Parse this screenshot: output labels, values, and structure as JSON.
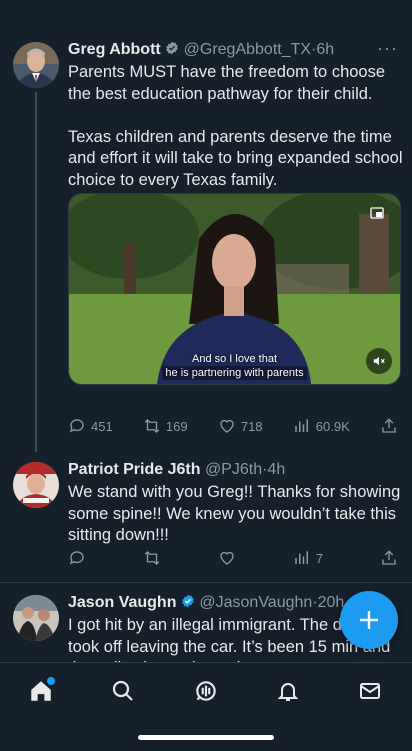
{
  "tweets": [
    {
      "name": "Greg Abbott",
      "handle": "@GregAbbott_TX",
      "time": "6h",
      "verified": true,
      "text": "Parents MUST have the freedom to choose the best education pathway for their child.\n\nTexas children and parents deserve the time and effort it will take to bring expanded school choice to every Texas family.",
      "media": {
        "caption_line1": "And so I love that",
        "caption_line2": "he is partnering with parents"
      },
      "actions": {
        "replies": "451",
        "retweets": "169",
        "likes": "718",
        "views": "60.9K"
      }
    },
    {
      "name": "Patriot Pride J6th",
      "handle": "@PJ6th",
      "time": "4h",
      "verified": false,
      "text": "We stand with you Greg!! Thanks for showing some spine!! We knew you wouldn’t take this sitting down!!!",
      "actions": {
        "views": "7"
      }
    },
    {
      "name": "Jason Vaughn",
      "handle": "@JasonVaughn",
      "time": "20h",
      "verified": true,
      "text": "I got hit by an illegal immigrant. The driver took off leaving the car. It’s been 15 min and the police have showed up"
    }
  ],
  "sep": "·",
  "more": "···",
  "colors": {
    "background": "#15202b",
    "accent": "#1d9bf0",
    "muted": "#8b98a5"
  },
  "tabs": [
    "home-icon",
    "search-icon",
    "spaces-icon",
    "notifications-icon",
    "messages-icon"
  ]
}
